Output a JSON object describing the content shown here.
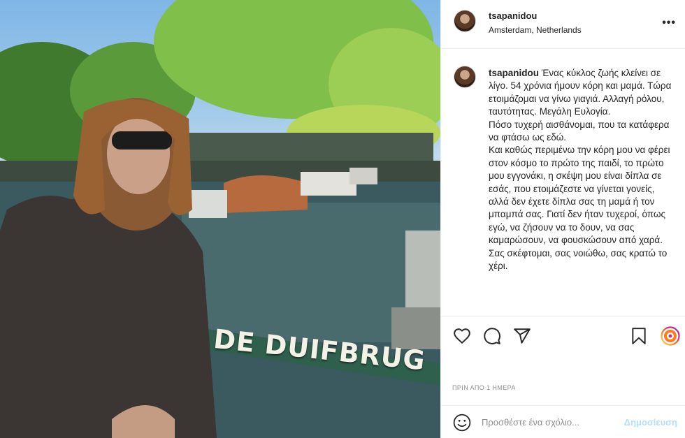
{
  "post": {
    "username": "tsapanidou",
    "location": "Amsterdam, Netherlands",
    "photo_sign_text": "DE DUIFBRUG",
    "caption_paragraphs": [
      "Ένας κύκλος ζωής κλείνει σε λίγο. 54 χρόνια ήμουν κόρη και μαμά. Τώρα ετοιμάζομαι να γίνω γιαγιά. Αλλαγή ρόλου, ταυτότητας. Μεγάλη Ευλογία.",
      "Πόσο τυχερή αισθάνομαι, που τα κατάφερα να φτάσω ως εδώ.",
      "Και καθώς περιμένω την κόρη μου να φέρει στον κόσμο το πρώτο της παιδί, το πρώτο μου εγγονάκι, η σκέψη μου είναι δίπλα σε εσάς, που ετοιμάζεστε να γίνεται γονείς, αλλά δεν έχετε δίπλα σας τη μαμά ή τον μπαμπά σας. Γιατί δεν ήταν τυχεροί, όπως εγώ, να ζήσουν να το δουν, να σας καμαρώσουν, να φουσκώσουν από χαρά.",
      "Σας σκέφτομαι, σας νοιώθω, σας κρατώ το χέρι."
    ],
    "timestamp": "ΠΡΙΝ ΑΠΟ 1 ΗΜΕΡΑ"
  },
  "comment": {
    "placeholder": "Προσθέστε ένα σχόλιο...",
    "post_label": "Δημοσίευση"
  },
  "icons": {
    "more": "more-options-icon",
    "like": "heart-icon",
    "comment": "comment-icon",
    "share": "send-icon",
    "save": "bookmark-icon",
    "story": "story-ring-icon",
    "emoji": "emoji-icon"
  },
  "colors": {
    "text": "#262626",
    "muted": "#8e8e8e",
    "post_button_disabled": "#b2dffc",
    "border": "#efefef"
  }
}
